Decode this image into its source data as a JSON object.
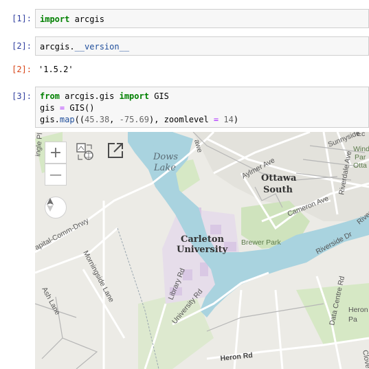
{
  "cells": [
    {
      "prompt": "[1]:",
      "code": {
        "kw": "import",
        "rest": " arcgis"
      }
    },
    {
      "prompt": "[2]:",
      "code": {
        "pre": "arcgis.",
        "attr": "__version__"
      }
    },
    {
      "out_prompt": "[2]:",
      "output": "'1.5.2'"
    },
    {
      "prompt": "[3]:",
      "line1": {
        "kw1": "from",
        "mid": " arcgis.gis ",
        "kw2": "import",
        "tail": " GIS"
      },
      "line2": {
        "pre": "gis ",
        "op": "=",
        "post": " GIS()"
      },
      "line3": {
        "pre": "gis.",
        "attr": "map",
        "open": "((",
        "n1": "45.38",
        "comma": ", ",
        "n2": "-75.69",
        "close": "), zoomlevel ",
        "op": "=",
        "sp": " ",
        "n3": "14",
        "end": ")"
      }
    }
  ],
  "map": {
    "controls": {
      "zoom_in": "+",
      "zoom_out": "—"
    },
    "icons": [
      "zoom-in-icon",
      "zoom-out-icon",
      "compass-icon",
      "basemap-switch-icon",
      "fullscreen-icon"
    ],
    "labels": {
      "dows_lake_1": "Dows",
      "dows_lake_2": "Lake",
      "ottawa_south_1": "Ottawa",
      "ottawa_south_2": "South",
      "carleton_1": "Carleton",
      "carleton_2": "University",
      "brewer_park": "Brewer Park",
      "aylmer_ave": "Aylmer Ave",
      "cameron_ave": "Cameron Ave",
      "riverside_dr": "Riverside Dr",
      "riverside_dr_2": "Riverside Dr",
      "riverdale_ave": "Riverdale Ave",
      "capital_comm": "apital-Comm-Drwy",
      "morningside": "Morningside Lane",
      "ash_lane": "Ash Lane",
      "library_rd": "Library Rd",
      "university_rd": "University Rd",
      "data_centre": "Data Centre Rd",
      "heron_rd": "Heron Rd",
      "heron_pa_1": "Heron",
      "heron_pa_2": "Pa",
      "sunnyside": "Sunnyside",
      "windsor_1": "Wind",
      "windsor_2": "Par",
      "windsor_3": "Otta",
      "clove": "Clove",
      "ec": "Ec",
      "ingle": "ingle Pl",
      "hawe": "awe"
    }
  },
  "colors": {
    "water": "#a9d3df",
    "park": "#cfe3bd",
    "campus": "#d9c8e4",
    "prompt": "#303f9f",
    "out_prompt": "#d84315"
  }
}
